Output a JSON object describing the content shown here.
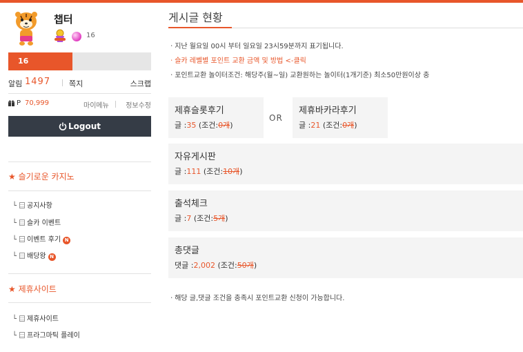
{
  "colors": {
    "accent": "#e8562a",
    "dark_button": "#353c46",
    "box_bg": "#f4f4f4"
  },
  "profile": {
    "username": "챕터",
    "avatar_icon": "tiger-mascot-icon",
    "level_badge_icon": "level-badge-icon",
    "gem_count": "16",
    "level_text": "16",
    "level_progress": 0.45
  },
  "stats": {
    "alarm_label": "알림",
    "alarm_value": "1497",
    "memo_label": "쪽지",
    "scrap_label": "스크랩"
  },
  "points": {
    "label": "P",
    "value": "70,999",
    "my_menu": "마이메뉴",
    "separator": "|",
    "edit_info": "정보수정"
  },
  "logout_label": "Logout",
  "sidebar": {
    "section1_title": "★ 슬기로운 카지노",
    "section1_items": [
      {
        "label": "공지사항",
        "new": false
      },
      {
        "label": "슬카 이벤트",
        "new": false
      },
      {
        "label": "이벤트 후기",
        "new": true
      },
      {
        "label": "배당왕",
        "new": true
      }
    ],
    "section2_title": "★ 제휴사이트",
    "section2_items": [
      {
        "label": "제휴사이트"
      },
      {
        "label": "프라그마틱 플레이"
      }
    ],
    "new_badge": "N"
  },
  "main": {
    "title": "게시글 현황",
    "notices": [
      "ㆍ지난 월요일 00시 부터 일요일 23시59분까지 표기됩니다.",
      "ㆍ슬카 레벨별 포인트 교환 금액 및 방법 <-클릭",
      "ㆍ포인트교환 놀이터조건: 해당주(월~일) 교환원하는 놀이터(1개기준) 최소50만원이상 충"
    ],
    "or_label": "OR",
    "boxes": [
      {
        "title": "제휴슬롯후기",
        "prefix": "글 :",
        "count": "35",
        "cond_open": " (조건:",
        "cond": "0개",
        "cond_close": ")"
      },
      {
        "title": "제휴바카라후기",
        "prefix": "글 :",
        "count": "21",
        "cond_open": " (조건:",
        "cond": "0개",
        "cond_close": ")"
      },
      {
        "title": "자유게시판",
        "prefix": "글 :",
        "count": "111",
        "cond_open": " (조건:",
        "cond": "10개",
        "cond_close": ")"
      },
      {
        "title": "출석체크",
        "prefix": "글 :",
        "count": "7",
        "cond_open": " (조건:",
        "cond": "5개",
        "cond_close": ")"
      },
      {
        "title": "총댓글",
        "prefix": "댓글 :",
        "count": "2,002",
        "cond_open": " (조건:",
        "cond": "50개",
        "cond_close": ")"
      }
    ],
    "footer_note": "ㆍ해당 글,댓글 조건을 충족시 포인트교환 신청이 가능합니다."
  }
}
